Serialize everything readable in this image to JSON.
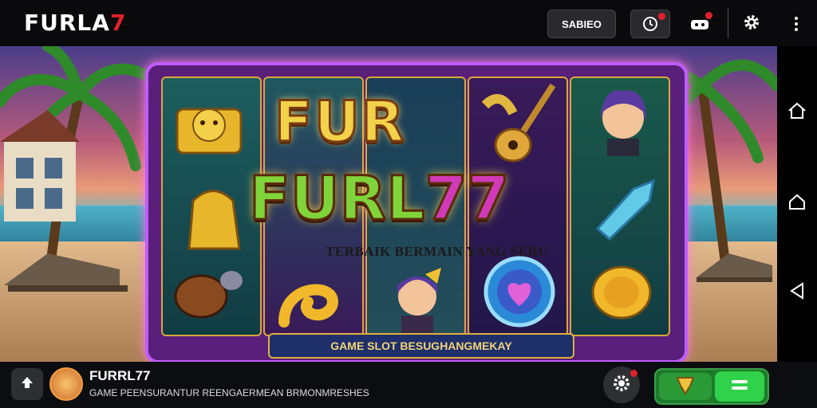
{
  "header": {
    "brand_main": "FURLA",
    "brand_accent": "7",
    "sign_in_label": "SABIEO",
    "icons": [
      "timer-icon",
      "gamepad-icon",
      "gear-icon",
      "more-vertical-icon"
    ]
  },
  "nav": {
    "icons": [
      "home-icon",
      "circle-home-icon",
      "back-triangle-icon"
    ]
  },
  "game": {
    "title_top": "FUR",
    "title_main_letters": "FURL",
    "title_main_number": "77",
    "tagline": "TERBAIK BERMAIN YANG SERU",
    "banner": "GAME SLOT BESUGHANGMEKAY"
  },
  "footer": {
    "app_name": "FURRL77",
    "app_desc": "GAME PEENSURANTUR REENGAERMEAN BRMONMRESHES"
  },
  "colors": {
    "brand_red": "#e0202a",
    "frame_purple": "#c05cff",
    "action_green": "#2fd24a"
  }
}
